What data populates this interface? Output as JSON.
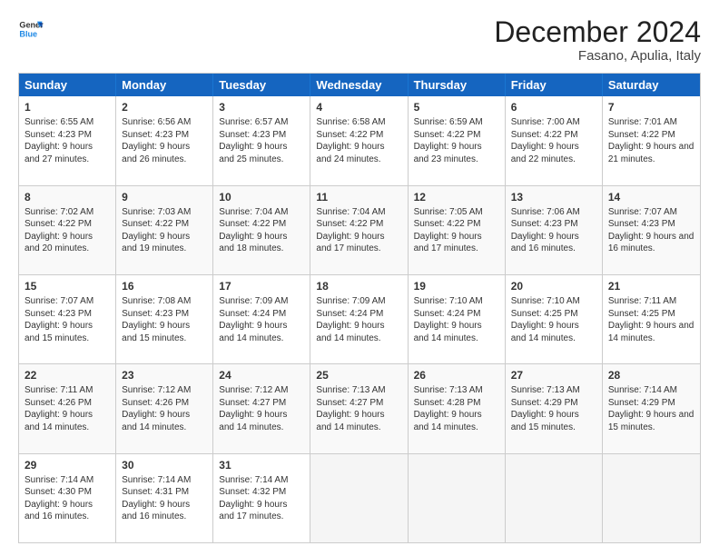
{
  "logo": {
    "general": "General",
    "blue": "Blue"
  },
  "title": "December 2024",
  "location": "Fasano, Apulia, Italy",
  "days_of_week": [
    "Sunday",
    "Monday",
    "Tuesday",
    "Wednesday",
    "Thursday",
    "Friday",
    "Saturday"
  ],
  "weeks": [
    [
      {
        "day": 1,
        "sunrise": "6:55 AM",
        "sunset": "4:23 PM",
        "daylight": "9 hours and 27 minutes"
      },
      {
        "day": 2,
        "sunrise": "6:56 AM",
        "sunset": "4:23 PM",
        "daylight": "9 hours and 26 minutes"
      },
      {
        "day": 3,
        "sunrise": "6:57 AM",
        "sunset": "4:23 PM",
        "daylight": "9 hours and 25 minutes"
      },
      {
        "day": 4,
        "sunrise": "6:58 AM",
        "sunset": "4:22 PM",
        "daylight": "9 hours and 24 minutes"
      },
      {
        "day": 5,
        "sunrise": "6:59 AM",
        "sunset": "4:22 PM",
        "daylight": "9 hours and 23 minutes"
      },
      {
        "day": 6,
        "sunrise": "7:00 AM",
        "sunset": "4:22 PM",
        "daylight": "9 hours and 22 minutes"
      },
      {
        "day": 7,
        "sunrise": "7:01 AM",
        "sunset": "4:22 PM",
        "daylight": "9 hours and 21 minutes"
      }
    ],
    [
      {
        "day": 8,
        "sunrise": "7:02 AM",
        "sunset": "4:22 PM",
        "daylight": "9 hours and 20 minutes"
      },
      {
        "day": 9,
        "sunrise": "7:03 AM",
        "sunset": "4:22 PM",
        "daylight": "9 hours and 19 minutes"
      },
      {
        "day": 10,
        "sunrise": "7:04 AM",
        "sunset": "4:22 PM",
        "daylight": "9 hours and 18 minutes"
      },
      {
        "day": 11,
        "sunrise": "7:04 AM",
        "sunset": "4:22 PM",
        "daylight": "9 hours and 17 minutes"
      },
      {
        "day": 12,
        "sunrise": "7:05 AM",
        "sunset": "4:22 PM",
        "daylight": "9 hours and 17 minutes"
      },
      {
        "day": 13,
        "sunrise": "7:06 AM",
        "sunset": "4:23 PM",
        "daylight": "9 hours and 16 minutes"
      },
      {
        "day": 14,
        "sunrise": "7:07 AM",
        "sunset": "4:23 PM",
        "daylight": "9 hours and 16 minutes"
      }
    ],
    [
      {
        "day": 15,
        "sunrise": "7:07 AM",
        "sunset": "4:23 PM",
        "daylight": "9 hours and 15 minutes"
      },
      {
        "day": 16,
        "sunrise": "7:08 AM",
        "sunset": "4:23 PM",
        "daylight": "9 hours and 15 minutes"
      },
      {
        "day": 17,
        "sunrise": "7:09 AM",
        "sunset": "4:24 PM",
        "daylight": "9 hours and 14 minutes"
      },
      {
        "day": 18,
        "sunrise": "7:09 AM",
        "sunset": "4:24 PM",
        "daylight": "9 hours and 14 minutes"
      },
      {
        "day": 19,
        "sunrise": "7:10 AM",
        "sunset": "4:24 PM",
        "daylight": "9 hours and 14 minutes"
      },
      {
        "day": 20,
        "sunrise": "7:10 AM",
        "sunset": "4:25 PM",
        "daylight": "9 hours and 14 minutes"
      },
      {
        "day": 21,
        "sunrise": "7:11 AM",
        "sunset": "4:25 PM",
        "daylight": "9 hours and 14 minutes"
      }
    ],
    [
      {
        "day": 22,
        "sunrise": "7:11 AM",
        "sunset": "4:26 PM",
        "daylight": "9 hours and 14 minutes"
      },
      {
        "day": 23,
        "sunrise": "7:12 AM",
        "sunset": "4:26 PM",
        "daylight": "9 hours and 14 minutes"
      },
      {
        "day": 24,
        "sunrise": "7:12 AM",
        "sunset": "4:27 PM",
        "daylight": "9 hours and 14 minutes"
      },
      {
        "day": 25,
        "sunrise": "7:13 AM",
        "sunset": "4:27 PM",
        "daylight": "9 hours and 14 minutes"
      },
      {
        "day": 26,
        "sunrise": "7:13 AM",
        "sunset": "4:28 PM",
        "daylight": "9 hours and 14 minutes"
      },
      {
        "day": 27,
        "sunrise": "7:13 AM",
        "sunset": "4:29 PM",
        "daylight": "9 hours and 15 minutes"
      },
      {
        "day": 28,
        "sunrise": "7:14 AM",
        "sunset": "4:29 PM",
        "daylight": "9 hours and 15 minutes"
      }
    ],
    [
      {
        "day": 29,
        "sunrise": "7:14 AM",
        "sunset": "4:30 PM",
        "daylight": "9 hours and 16 minutes"
      },
      {
        "day": 30,
        "sunrise": "7:14 AM",
        "sunset": "4:31 PM",
        "daylight": "9 hours and 16 minutes"
      },
      {
        "day": 31,
        "sunrise": "7:14 AM",
        "sunset": "4:32 PM",
        "daylight": "9 hours and 17 minutes"
      },
      null,
      null,
      null,
      null
    ]
  ]
}
